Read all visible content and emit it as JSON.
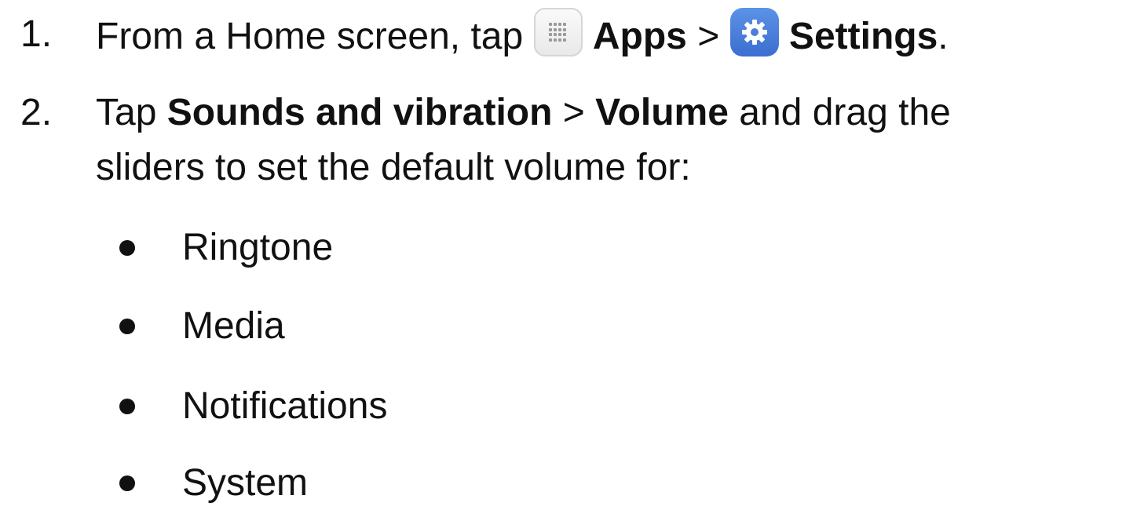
{
  "steps": [
    {
      "number": "1.",
      "prefix": "From a Home screen, tap ",
      "apps_label": "Apps",
      "separator1": " > ",
      "settings_label": "Settings",
      "suffix": "."
    },
    {
      "number": "2.",
      "prefix": "Tap ",
      "sounds_label": "Sounds and vibration",
      "separator": " > ",
      "volume_label": "Volume",
      "suffix_line1": " and drag the",
      "line2": "sliders to set the default volume for:"
    }
  ],
  "volume_types": [
    "Ringtone",
    "Media",
    "Notifications",
    "System"
  ],
  "icons": {
    "apps": "apps-grid-icon",
    "settings": "settings-gear-icon"
  },
  "colors": {
    "settings_icon_bg": "#4a80dc",
    "text": "#111111"
  }
}
